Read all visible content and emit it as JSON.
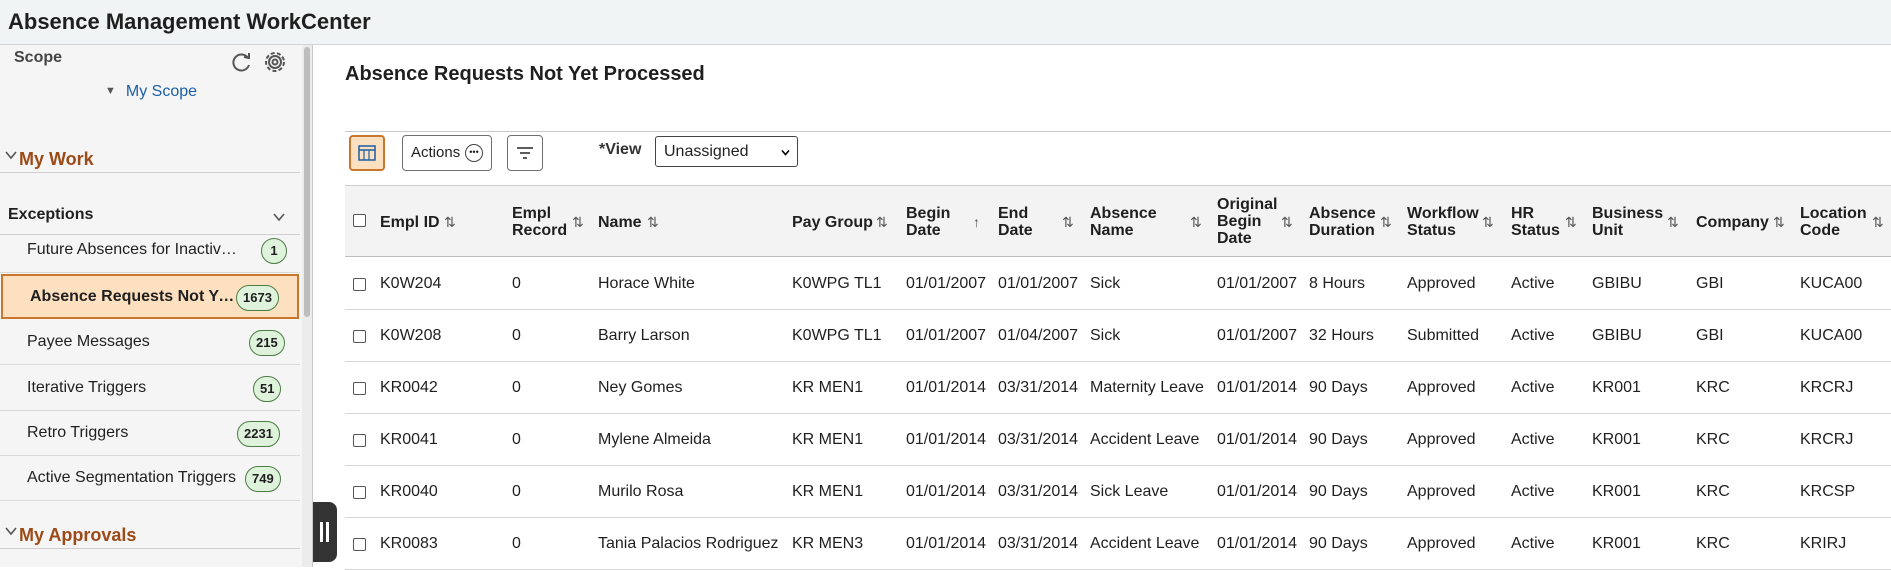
{
  "app": {
    "title": "Absence Management WorkCenter"
  },
  "sidebar": {
    "scope_label": "Scope",
    "my_scope": "My Scope",
    "my_work": "My Work",
    "exceptions_label": "Exceptions",
    "my_approvals": "My Approvals",
    "items": [
      {
        "label": "Future Absences for Inactive Employees",
        "count": "1"
      },
      {
        "label": "Absence Requests Not Yet Processed",
        "count": "1673",
        "selected": true
      },
      {
        "label": "Payee Messages",
        "count": "215"
      },
      {
        "label": "Iterative Triggers",
        "count": "51"
      },
      {
        "label": "Retro Triggers",
        "count": "2231"
      },
      {
        "label": "Active Segmentation Triggers",
        "count": "749"
      }
    ]
  },
  "main": {
    "title": "Absence Requests Not Yet Processed",
    "actions_label": "Actions",
    "view_label": "*View",
    "view_value": "Unassigned"
  },
  "table": {
    "headers": [
      "Empl ID",
      "Empl Record",
      "Name",
      "Pay Group",
      "Begin Date",
      "End Date",
      "Absence Name",
      "Original Begin Date",
      "Absence Duration",
      "Workflow Status",
      "HR Status",
      "Business Unit",
      "Company",
      "Location Code"
    ],
    "rows": [
      [
        "K0W204",
        "0",
        "Horace White",
        "K0WPG TL1",
        "01/01/2007",
        "01/01/2007",
        "Sick",
        "01/01/2007",
        "8 Hours",
        "Approved",
        "Active",
        "GBIBU",
        "GBI",
        "KUCA00"
      ],
      [
        "K0W208",
        "0",
        "Barry Larson",
        "K0WPG TL1",
        "01/01/2007",
        "01/04/2007",
        "Sick",
        "01/01/2007",
        "32 Hours",
        "Submitted",
        "Active",
        "GBIBU",
        "GBI",
        "KUCA00"
      ],
      [
        "KR0042",
        "0",
        "Ney Gomes",
        "KR MEN1",
        "01/01/2014",
        "03/31/2014",
        "Maternity Leave",
        "01/01/2014",
        "90 Days",
        "Approved",
        "Active",
        "KR001",
        "KRC",
        "KRCRJ"
      ],
      [
        "KR0041",
        "0",
        "Mylene Almeida",
        "KR MEN1",
        "01/01/2014",
        "03/31/2014",
        "Accident Leave",
        "01/01/2014",
        "90 Days",
        "Approved",
        "Active",
        "KR001",
        "KRC",
        "KRCRJ"
      ],
      [
        "KR0040",
        "0",
        "Murilo Rosa",
        "KR MEN1",
        "01/01/2014",
        "03/31/2014",
        "Sick Leave",
        "01/01/2014",
        "90 Days",
        "Approved",
        "Active",
        "KR001",
        "KRC",
        "KRCSP"
      ],
      [
        "KR0083",
        "0",
        "Tania Palacios Rodriguez",
        "KR MEN3",
        "01/01/2014",
        "03/31/2014",
        "Accident Leave",
        "01/01/2014",
        "90 Days",
        "Approved",
        "Active",
        "KR001",
        "KRC",
        "KRIRJ"
      ]
    ]
  }
}
